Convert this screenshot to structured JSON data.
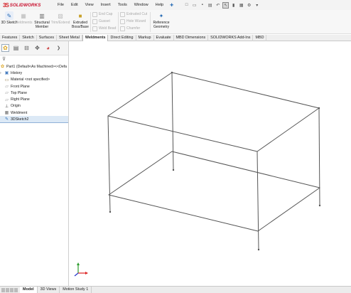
{
  "app": {
    "logo_mark": "3S",
    "logo_text": "SOLIDWORKS"
  },
  "menus": [
    "File",
    "Edit",
    "View",
    "Insert",
    "Tools",
    "Window",
    "Help"
  ],
  "command_manager": {
    "sketch_3d": "3D Sketch",
    "weldments": "Weldments",
    "structural_member": "Structural Member",
    "trim_extend": "Trim/Extend",
    "extruded_boss": "Extruded Boss/Base",
    "end_cap": "End Cap",
    "gusset": "Gusset",
    "weld_bead": "Weld Bead",
    "extruded_cut": "Extruded Cut",
    "hole_wizard": "Hole Wizard",
    "chamfer": "Chamfer",
    "reference_geometry": "Reference Geometry"
  },
  "tabs": [
    "Features",
    "Sketch",
    "Surfaces",
    "Sheet Metal",
    "Weldments",
    "Direct Editing",
    "Markup",
    "Evaluate",
    "MBD Dimensions",
    "SOLIDWORKS Add-Ins",
    "MBD"
  ],
  "active_tab": "Weldments",
  "feature_tree": {
    "root": "Part1  (Default<As Machined><<Defa",
    "items": [
      "History",
      "Material <not specified>",
      "Front Plane",
      "Top Plane",
      "Right Plane",
      "Origin",
      "Weldment",
      "3DSketch2"
    ]
  },
  "bottom_tabs": [
    "Model",
    "3D Views",
    "Motion Study 1"
  ],
  "active_bottom_tab": "Model",
  "colors": {
    "accent": "#c8102e",
    "selection": "#dce9f6",
    "frame_line": "#555555"
  }
}
